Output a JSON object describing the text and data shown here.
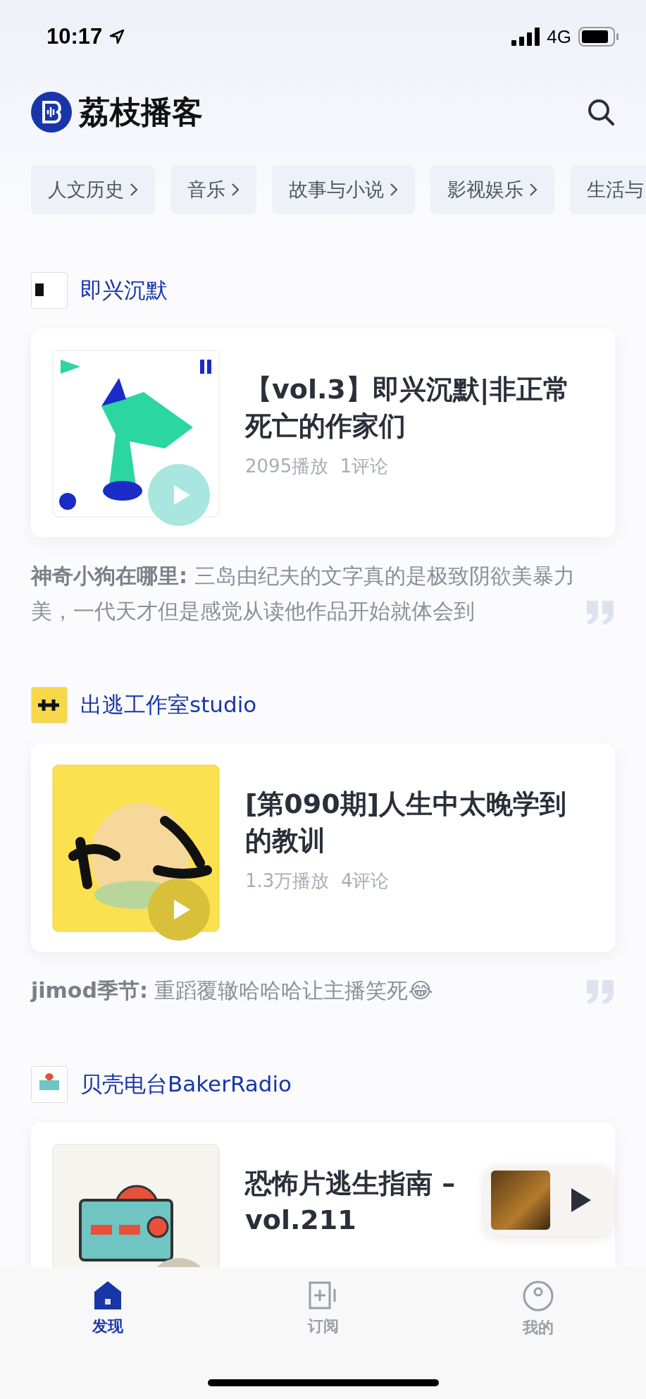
{
  "status_bar": {
    "time": "10:17",
    "network": "4G"
  },
  "header": {
    "app_name": "荔枝播客"
  },
  "categories": [
    {
      "label": "人文历史",
      "chevron": true
    },
    {
      "label": "音乐",
      "chevron": true
    },
    {
      "label": "故事与小说",
      "chevron": true
    },
    {
      "label": "影视娱乐",
      "chevron": true
    },
    {
      "label": "生活与",
      "chevron": false
    }
  ],
  "feed": [
    {
      "channel": "即兴沉默",
      "kind": "impromptu",
      "title_lines": [
        "【vol.3】即兴沉默|非正常",
        "死亡的作家们"
      ],
      "stats": "2095播放  1评论",
      "comment": "**神奇小狗在哪里:** 三岛由纪夫的文字真的是极致阴欲美暴力美，一代天才但是感觉从读他作品开始就体会到"
    },
    {
      "channel": "出逃工作室studio",
      "kind": "escape",
      "title_lines": [
        "[第090期]人生中太晚学到",
        "的教训"
      ],
      "stats": "1.3万播放  4评论",
      "comment": "**jimod季节:** 重蹈覆辙哈哈哈让主播笑死😂"
    },
    {
      "channel": "贝壳电台BakerRadio",
      "kind": "shell",
      "title_lines": [
        "恐怖片逃生指南 –",
        "vol.211"
      ]
    }
  ],
  "tabs": [
    {
      "label": "发现",
      "kind": "home",
      "selected": true
    },
    {
      "label": "订阅",
      "kind": "subscribe",
      "selected": false
    },
    {
      "label": "我的",
      "kind": "profile",
      "selected": false
    }
  ]
}
